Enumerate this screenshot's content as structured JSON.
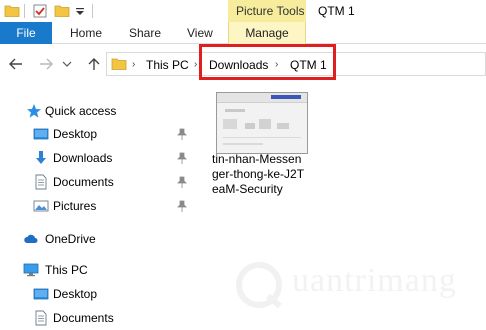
{
  "window": {
    "title": "QTM 1"
  },
  "ribbon": {
    "context_group": "Picture Tools",
    "tabs": [
      {
        "label": "File"
      },
      {
        "label": "Home"
      },
      {
        "label": "Share"
      },
      {
        "label": "View"
      },
      {
        "label": "Manage"
      }
    ]
  },
  "address": {
    "crumbs": [
      "This PC",
      "Downloads",
      "QTM 1"
    ]
  },
  "nav_pane": {
    "items": [
      {
        "label": "Quick access",
        "icon": "star-icon"
      },
      {
        "label": "Desktop",
        "icon": "desktop-folder-icon",
        "pinned": true
      },
      {
        "label": "Downloads",
        "icon": "download-arrow-icon",
        "pinned": true
      },
      {
        "label": "Documents",
        "icon": "document-icon",
        "pinned": true
      },
      {
        "label": "Pictures",
        "icon": "picture-icon",
        "pinned": true
      },
      {
        "label": "OneDrive",
        "icon": "cloud-icon"
      },
      {
        "label": "This PC",
        "icon": "computer-icon"
      },
      {
        "label": "Desktop",
        "icon": "desktop-folder-icon"
      },
      {
        "label": "Documents",
        "icon": "document-icon"
      }
    ]
  },
  "content": {
    "file": {
      "name_lines": [
        "tin-nhan-Messen",
        "ger-thong-ke-J2T",
        "eaM-Security"
      ]
    }
  },
  "watermark": {
    "text": "uantrimang"
  },
  "colors": {
    "file_tab": "#1979ca",
    "context_tab": "#f6ec9c",
    "highlight": "#e01e1e"
  }
}
